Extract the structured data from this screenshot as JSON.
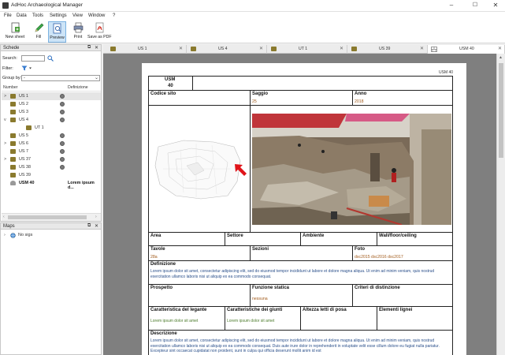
{
  "window": {
    "title": "AdHoc Archaeological Manager",
    "controls": [
      "–",
      "☐",
      "✕"
    ]
  },
  "menu": [
    "File",
    "Data",
    "Tools",
    "Settings",
    "View",
    "Window",
    "?"
  ],
  "toolbar": [
    {
      "label": "New sheet",
      "icon": "new-sheet-icon"
    },
    {
      "label": "Fill",
      "icon": "pencil-icon"
    },
    {
      "label": "Preview",
      "icon": "preview-icon",
      "active": true
    },
    {
      "label": "Print",
      "icon": "printer-icon"
    },
    {
      "label": "Save as PDF",
      "icon": "pdf-icon"
    }
  ],
  "schede_panel": {
    "title": "Schede",
    "search_label": "Search:",
    "filter_label": "Filter:",
    "group_label": "Group by:",
    "group_value": "-",
    "col_number": "Number",
    "col_definition": "Definizione",
    "rows": [
      {
        "label": "US 1",
        "expander": ">",
        "dot": true,
        "selected": true
      },
      {
        "label": "US 2",
        "expander": "",
        "dot": true
      },
      {
        "label": "US 3",
        "expander": "",
        "dot": true
      },
      {
        "label": "US 4",
        "expander": "v",
        "dot": true
      },
      {
        "label": "UT 1",
        "expander": "",
        "dot": false,
        "child": true
      },
      {
        "label": "US 5",
        "expander": "",
        "dot": true
      },
      {
        "label": "US 6",
        "expander": ">",
        "dot": true
      },
      {
        "label": "US 7",
        "expander": "",
        "dot": true
      },
      {
        "label": "US 37",
        "expander": ">",
        "dot": true
      },
      {
        "label": "US 38",
        "expander": "",
        "dot": true
      },
      {
        "label": "US 39",
        "expander": "",
        "dot": false
      },
      {
        "label": "USM 40",
        "expander": "",
        "dot": false,
        "bold": true,
        "definition": "Lorem ipsum d..."
      }
    ]
  },
  "maps_panel": {
    "title": "Maps",
    "item": "No sigs"
  },
  "tabs": [
    "US 1",
    "US 4",
    "UT 1",
    "US 39",
    "USM 40"
  ],
  "sheet": {
    "corner_label": "USM 40",
    "id_label": "USM",
    "id_value": "40",
    "codice_sito_label": "Codice sito",
    "saggio_label": "Saggio",
    "saggio_value": "25",
    "anno_label": "Anno",
    "anno_value": "2018",
    "area_label": "Area",
    "settore_label": "Settore",
    "ambiente_label": "Ambiente",
    "wall_label": "Wall/floor/ceiling",
    "tavole_label": "Tavole",
    "tavole_value": "28a",
    "sezioni_label": "Sezioni",
    "foto_label": "Foto",
    "foto_value": "dsc2015 dsc2016 dsc2017",
    "definizione_label": "Definizione",
    "definizione_text": "Lorem ipsum dolor sit amet, consectetur adipiscing elit, sed do eiusmod tempor incididunt ut labore et dolore magna aliqua. Ut enim ad minim veniam, quis nostrud exercitation ullamco laboris nisi ut aliquip ex ea commodo consequat.",
    "prospetto_label": "Prospetto",
    "funzione_label": "Funzione statica",
    "funzione_value": "nessuna",
    "criteri_label": "Criteri di distinzione",
    "legante_label": "Caratteristica del legante",
    "legante_text": "Lorem ipsum dolor sit amet",
    "giunti_label": "Caratteristiche dei giunti",
    "giunti_text": "Lorem ipsum dolor sit amet",
    "altezza_label": "Altezza letti di posa",
    "elementi_label": "Elementi lignei",
    "descrizione_label": "Descrizione",
    "descrizione_text": "Lorem ipsum dolor sit amet, consectetur adipiscing elit, sed do eiusmod tempor incididunt ut labore et dolore magna aliqua. Ut enim ad minim veniam, quis nostrud exercitation ullamco laboris nisi ut aliquip ex ea commodo consequat. Duis aute irure dolor in reprehenderit in voluptate velit esse cillum dolore eu fugiat nulla pariatur. Excepteur sint occaecat cupidatat non proident, sunt in culpa qui officia deserunt mollit anim id est"
  },
  "colors": {
    "accent": "#7ab1e0",
    "value_text": "#a15a1a",
    "lorem_text": "#2a4f8a",
    "page_bg": "#7f7f7f"
  }
}
